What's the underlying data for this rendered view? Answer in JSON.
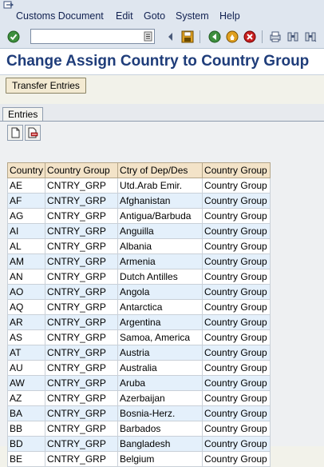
{
  "menu": {
    "items": [
      "Customs Document",
      "Edit",
      "Goto",
      "System",
      "Help"
    ]
  },
  "toolbar": {
    "command_value": "",
    "icons": [
      "check-icon",
      "save-icon",
      "back-icon",
      "exit-icon",
      "cancel-icon",
      "print-icon",
      "find-icon",
      "find-next-icon"
    ]
  },
  "title": "Change Assign Country to Country Group",
  "app_toolbar": {
    "transfer_label": "Transfer Entries"
  },
  "entries": {
    "tab_label": "Entries",
    "columns": [
      "Country",
      "Country Group",
      "Ctry of Dep/Des",
      "Country Group"
    ],
    "rows": [
      [
        "AE",
        "CNTRY_GRP",
        "Utd.Arab Emir.",
        "Country Group"
      ],
      [
        "AF",
        "CNTRY_GRP",
        "Afghanistan",
        "Country Group"
      ],
      [
        "AG",
        "CNTRY_GRP",
        "Antigua/Barbuda",
        "Country Group"
      ],
      [
        "AI",
        "CNTRY_GRP",
        "Anguilla",
        "Country Group"
      ],
      [
        "AL",
        "CNTRY_GRP",
        "Albania",
        "Country Group"
      ],
      [
        "AM",
        "CNTRY_GRP",
        "Armenia",
        "Country Group"
      ],
      [
        "AN",
        "CNTRY_GRP",
        "Dutch Antilles",
        "Country Group"
      ],
      [
        "AO",
        "CNTRY_GRP",
        "Angola",
        "Country Group"
      ],
      [
        "AQ",
        "CNTRY_GRP",
        "Antarctica",
        "Country Group"
      ],
      [
        "AR",
        "CNTRY_GRP",
        "Argentina",
        "Country Group"
      ],
      [
        "AS",
        "CNTRY_GRP",
        "Samoa, America",
        "Country Group"
      ],
      [
        "AT",
        "CNTRY_GRP",
        "Austria",
        "Country Group"
      ],
      [
        "AU",
        "CNTRY_GRP",
        "Australia",
        "Country Group"
      ],
      [
        "AW",
        "CNTRY_GRP",
        "Aruba",
        "Country Group"
      ],
      [
        "AZ",
        "CNTRY_GRP",
        "Azerbaijan",
        "Country Group"
      ],
      [
        "BA",
        "CNTRY_GRP",
        "Bosnia-Herz.",
        "Country Group"
      ],
      [
        "BB",
        "CNTRY_GRP",
        "Barbados",
        "Country Group"
      ],
      [
        "BD",
        "CNTRY_GRP",
        "Bangladesh",
        "Country Group"
      ],
      [
        "BE",
        "CNTRY_GRP",
        "Belgium",
        "Country Group"
      ]
    ]
  },
  "colors": {
    "title": "#1f3d7a",
    "header_bg": "#f3e3c8",
    "row_alt": "#e4f0fb"
  }
}
